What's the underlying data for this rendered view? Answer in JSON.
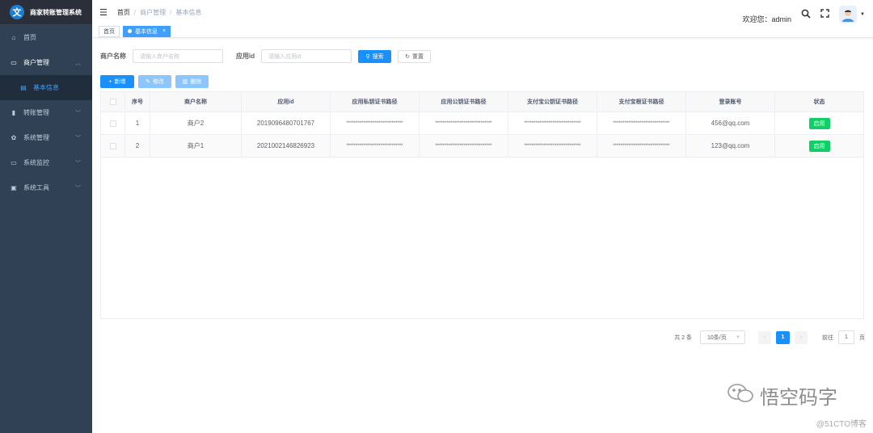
{
  "app": {
    "logo_char": "文",
    "title": "商家转账管理系统"
  },
  "sidebar": {
    "items": [
      {
        "icon": "home-icon",
        "glyph": "⌂",
        "label": "首页"
      },
      {
        "icon": "shop-icon",
        "glyph": "▭",
        "label": "商户管理",
        "arrow": "︿"
      },
      {
        "icon": "list-icon",
        "glyph": "▤",
        "label": "基本信息"
      },
      {
        "icon": "transfer-icon",
        "glyph": "▮",
        "label": "转账管理",
        "arrow": "﹀"
      },
      {
        "icon": "gear-icon",
        "glyph": "✿",
        "label": "系统管理",
        "arrow": "﹀"
      },
      {
        "icon": "monitor-icon",
        "glyph": "▭",
        "label": "系统监控",
        "arrow": "﹀"
      },
      {
        "icon": "tool-icon",
        "glyph": "▣",
        "label": "系统工具",
        "arrow": "﹀"
      }
    ]
  },
  "header": {
    "breadcrumb": [
      "首页",
      "商户管理",
      "基本信息"
    ],
    "sep": "/",
    "welcome": "欢迎您：admin"
  },
  "tags": {
    "home": "首页",
    "active": "基本信息",
    "close": "×"
  },
  "search": {
    "name_label": "商户名称",
    "name_placeholder": "请输入商户名称",
    "appid_label": "应用id",
    "appid_placeholder": "请输入应用id",
    "search_btn": "搜索",
    "reset_btn": "重置"
  },
  "actions": {
    "add": "新增",
    "edit": "修改",
    "delete": "删除"
  },
  "table": {
    "headers": [
      "",
      "序号",
      "商户名称",
      "应用id",
      "应用私钥证书路径",
      "应用公钥证书路径",
      "支付宝公钥证书路径",
      "支付宝根证书路径",
      "登录账号",
      "状态"
    ],
    "rows": [
      {
        "index": "1",
        "name": "商户2",
        "appid": "2019096480701767",
        "k1": "******************************",
        "k2": "******************************",
        "k3": "******************************",
        "k4": "******************************",
        "account": "456@qq.com",
        "status": "启用"
      },
      {
        "index": "2",
        "name": "商户1",
        "appid": "2021002146826923",
        "k1": "******************************",
        "k2": "******************************",
        "k3": "******************************",
        "k4": "******************************",
        "account": "123@qq.com",
        "status": "启用"
      }
    ]
  },
  "pagination": {
    "total": "共 2 条",
    "size": "10条/页",
    "prev": "‹",
    "page": "1",
    "next": "›",
    "goto": "前往",
    "goto_value": "1",
    "unit": "页"
  },
  "watermark": {
    "text": "悟空码字",
    "site": "@51CTO博客"
  },
  "colors": {
    "sidebar": "#304156",
    "primary": "#1890ff",
    "success": "#13ce66"
  }
}
